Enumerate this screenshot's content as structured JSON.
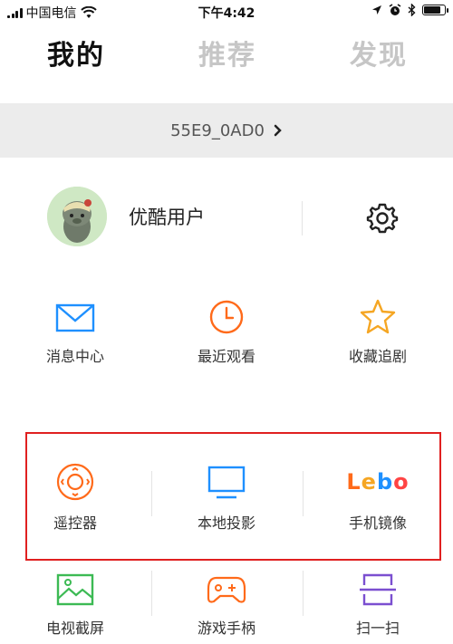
{
  "status_bar": {
    "carrier": "中国电信",
    "time": "下午4:42",
    "battery_level": 0.8,
    "icons": [
      "signal-icon",
      "wifi-icon",
      "location-icon",
      "alarm-icon",
      "bluetooth-icon",
      "battery-icon"
    ]
  },
  "top_tabs": [
    {
      "label": "我的",
      "active": true
    },
    {
      "label": "推荐",
      "active": false
    },
    {
      "label": "发现",
      "active": false
    }
  ],
  "device": {
    "name": "55E9_0AD0",
    "icon": "chevron-right-icon"
  },
  "user": {
    "name": "优酷用户",
    "avatar_icon": "avatar",
    "settings_icon": "gear-icon"
  },
  "shortcuts": [
    {
      "label": "消息中心",
      "icon": "mail-icon",
      "color": "#1e90ff"
    },
    {
      "label": "最近观看",
      "icon": "clock-icon",
      "color": "#ff6a1a"
    },
    {
      "label": "收藏追剧",
      "icon": "star-icon",
      "color": "#f5a623"
    }
  ],
  "tools": [
    {
      "label": "遥控器",
      "icon": "remote-icon",
      "color": "#ff6a1a"
    },
    {
      "label": "本地投影",
      "icon": "tv-icon",
      "color": "#1e90ff"
    },
    {
      "label": "手机镜像",
      "icon": "lebo-logo",
      "logo_text": "Lebo"
    },
    {
      "label": "电视截屏",
      "icon": "picture-icon",
      "color": "#3cba54"
    },
    {
      "label": "游戏手柄",
      "icon": "gamepad-icon",
      "color": "#ff6a1a"
    },
    {
      "label": "扫一扫",
      "icon": "scan-icon",
      "color": "#7b4fd0"
    }
  ],
  "colors": {
    "highlight_border": "#e02020",
    "device_bar_bg": "#ececec",
    "inactive_tab": "#c6c6c6"
  }
}
